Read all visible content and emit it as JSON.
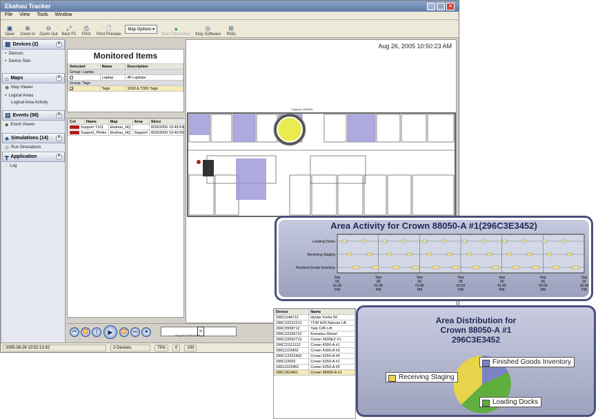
{
  "window": {
    "title": "Ekahau Tracker"
  },
  "menu": [
    "File",
    "View",
    "Tools",
    "Window"
  ],
  "toolbar": {
    "buttons": [
      {
        "label": "Save",
        "icon": "save-icon"
      },
      {
        "label": "Zoom In",
        "icon": "zoom-in-icon"
      },
      {
        "label": "Zoom Out",
        "icon": "zoom-out-icon"
      },
      {
        "label": "Best Fit",
        "icon": "best-fit-icon"
      },
      {
        "label": "Print",
        "icon": "print-icon"
      },
      {
        "label": "Print Preview",
        "icon": "print-preview-icon"
      }
    ],
    "map_options": "Map Options",
    "right_buttons": [
      {
        "label": "Start Simulation",
        "icon": "play-sim-icon",
        "disabled": true
      },
      {
        "label": "Stop Software",
        "icon": "stop-icon",
        "disabled": false
      },
      {
        "label": "Plots",
        "icon": "plots-icon",
        "disabled": false
      }
    ]
  },
  "sidebar": {
    "sections": [
      {
        "header": "Devices (2)",
        "items": [
          "Devices",
          "Device Sets"
        ]
      },
      {
        "header": "Maps",
        "items": [
          "Map Viewer",
          "Logical Areas",
          "Logical Area Activity"
        ]
      },
      {
        "header": "Events (58)",
        "items": [
          "Event Viewer"
        ]
      },
      {
        "header": "Simulations (14)",
        "items": [
          "Run Simulations"
        ]
      },
      {
        "header": "Application",
        "items": [
          "Log"
        ]
      }
    ]
  },
  "monitored": {
    "title": "Monitored Items",
    "columns": [
      "Selected",
      "Name",
      "Description"
    ],
    "rows": [
      {
        "kind": "group",
        "text": "Group: Laptop"
      },
      {
        "kind": "item",
        "name": "Laptop",
        "desc": "All Laptops"
      },
      {
        "kind": "group",
        "text": "Group: Tags"
      },
      {
        "kind": "item",
        "name": "Tags",
        "desc": "1000 & T301 Tags",
        "highlight": true
      }
    ]
  },
  "devlist": {
    "columns": [
      "Col",
      "Name",
      "Map",
      "Area",
      "Since"
    ],
    "rows": [
      {
        "name": "Support T101",
        "map": "Ekahau_HQ",
        "area": "",
        "since": "8/26/2005 10:49:54"
      },
      {
        "name": "Support_Pfeiko",
        "map": "Ekahau_HQ",
        "area": "Support",
        "since": "8/26/2005 10:49:55"
      }
    ]
  },
  "map": {
    "timestamp": "Aug 26, 2005 10:50:23 AM",
    "room_label": "Support_DDDBA"
  },
  "playback": {
    "slider_label": "Aug 26 10:50:23 AM"
  },
  "status": {
    "left": "2005-08-26 10:52:13.92",
    "devices": "2 Devices",
    "zoom": "75%",
    "count": "0",
    "scale": "100"
  },
  "activity": {
    "title": "Area Activity for Crown 88050-A #1(296C3E3452)",
    "rows": [
      "Loading Docks",
      "Receiving Staging",
      "Finished Goods Inventory"
    ],
    "ticks": [
      [
        "Sep",
        "06",
        "01:35",
        "PM"
      ],
      [
        "Sep",
        "06",
        "01:40",
        "PM"
      ],
      [
        "Sep",
        "06",
        "01:45",
        "PM"
      ],
      [
        "Sep",
        "06",
        "01:50",
        "PM"
      ],
      [
        "Sep",
        "06",
        "01:55",
        "PM"
      ],
      [
        "Sep",
        "06",
        "02:00",
        "PM"
      ],
      [
        "Sep",
        "06",
        "02:05",
        "PM"
      ]
    ]
  },
  "devices_table": {
    "columns": [
      "Device",
      "Name"
    ],
    "rows": [
      [
        "29611148712",
        "Hyster Forks 50"
      ],
      [
        "296C32222212",
        "TCM H25 Narrow Lift"
      ],
      [
        "296C5558712",
        "Yale C45 Lift"
      ],
      [
        "296C22326712",
        "Komatsu Diesel"
      ],
      [
        "296C22002712",
        "Crown 3600EZ #1"
      ],
      [
        "296C21111112",
        "Crown 4300-A #1"
      ],
      [
        "29611123452",
        "Crown 4300-A #3"
      ],
      [
        "296C12322402",
        "Crown 5250-A #6"
      ],
      [
        "296C22002",
        "Crown 5250-A #1"
      ],
      [
        "29611223452",
        "Crown 5250-A #5"
      ],
      [
        "296C3E3452",
        "Crown 88050-A #1"
      ]
    ]
  },
  "distribution": {
    "title_lines": [
      "Area Distribution for",
      "Crown 88050-A #1",
      "296C3E3452"
    ],
    "legend": [
      {
        "label": "Finished Goods Inventory",
        "color": "#7c82c4"
      },
      {
        "label": "Receiving Staging",
        "color": "#e8d44a"
      },
      {
        "label": "Loading Docks",
        "color": "#5fae3e"
      }
    ]
  }
}
